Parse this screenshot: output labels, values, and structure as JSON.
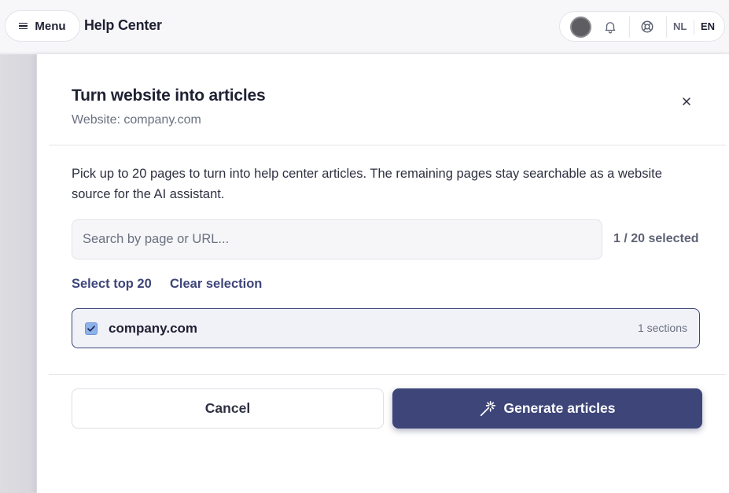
{
  "header": {
    "menu_label": "Menu",
    "title": "Help Center",
    "languages": {
      "nl": "NL",
      "en": "EN"
    },
    "icons": [
      "hamburger-icon",
      "avatar",
      "bell-icon",
      "lifebuoy-icon"
    ]
  },
  "modal": {
    "title": "Turn website into articles",
    "subtitle": "Website: company.com",
    "description": "Pick up to 20 pages to turn into help center articles. The remaining pages stay searchable as a website source for the AI assistant.",
    "search": {
      "placeholder": "Search by page or URL...",
      "value": ""
    },
    "selected_count": "1 / 20 selected",
    "select_top_label": "Select top 20",
    "clear_label": "Clear selection",
    "pages": [
      {
        "name": "company.com",
        "meta": "1 sections",
        "checked": true
      }
    ],
    "cancel_label": "Cancel",
    "generate_label": "Generate articles"
  },
  "colors": {
    "accent": "#3d4579",
    "checkbox": "#8db2ea",
    "text": "#1f2133",
    "muted": "#6b7080"
  }
}
